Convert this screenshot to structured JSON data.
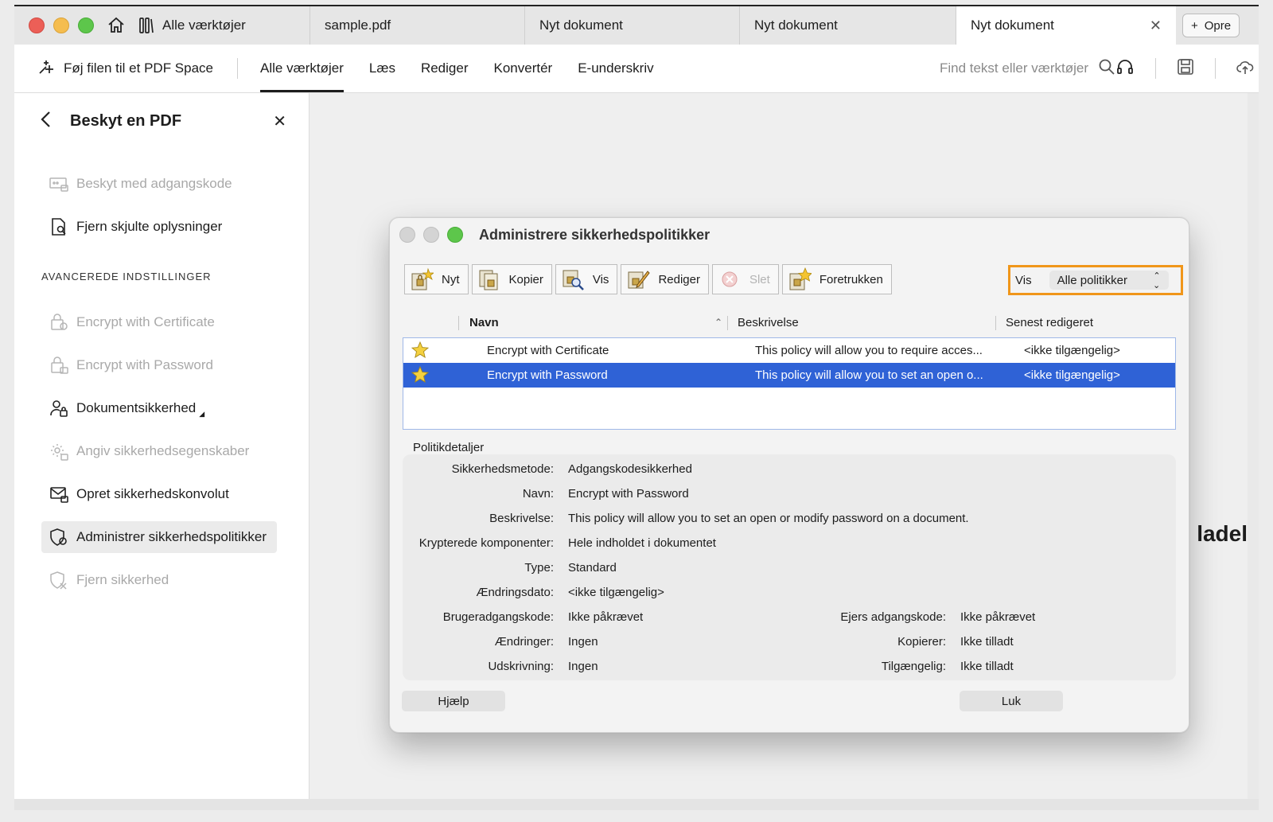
{
  "tabs": {
    "tools": "Alle værktøjer",
    "sample": "sample.pdf",
    "doc1": "Nyt dokument",
    "doc2": "Nyt dokument",
    "doc3": "Nyt dokument",
    "new_button": "Opre"
  },
  "toolbar": {
    "add_space": "Føj filen til et PDF Space",
    "menu": [
      "Alle værktøjer",
      "Læs",
      "Rediger",
      "Konvertér",
      "E-underskriv"
    ],
    "search_placeholder": "Find tekst eller værktøjer"
  },
  "panel": {
    "title": "Beskyt en PDF",
    "items_top": [
      "Beskyt med adgangskode",
      "Fjern skjulte oplysninger"
    ],
    "section": "AVANCEREDE INDSTILLINGER",
    "items_adv": [
      "Encrypt with Certificate",
      "Encrypt with Password",
      "Dokumentsikkerhed",
      "Angiv sikkerhedsegenskaber",
      "Opret sikkerhedskonvolut",
      "Administrer sikkerhedspolitikker",
      "Fjern sikkerhed"
    ]
  },
  "content": {
    "peek": "ladel"
  },
  "dialog": {
    "title": "Administrere sikkerhedspolitikker",
    "buttons": {
      "new": "Nyt",
      "copy": "Kopier",
      "view": "Vis",
      "edit": "Rediger",
      "delete": "Slet",
      "favorite": "Foretrukken"
    },
    "filter": {
      "label": "Vis",
      "value": "Alle politikker"
    },
    "columns": {
      "name": "Navn",
      "description": "Beskrivelse",
      "modified": "Senest redigeret"
    },
    "rows": [
      {
        "name": "Encrypt with Certificate",
        "description": "This policy will allow you to require acces...",
        "modified": "<ikke tilgængelig>"
      },
      {
        "name": "Encrypt with Password",
        "description": "This policy will allow you to set an open o...",
        "modified": "<ikke tilgængelig>"
      }
    ],
    "details_label": "Politikdetaljer",
    "details": {
      "method_k": "Sikkerhedsmetode:",
      "method_v": "Adgangskodesikkerhed",
      "name_k": "Navn:",
      "name_v": "Encrypt with Password",
      "desc_k": "Beskrivelse:",
      "desc_v": "This policy will allow you to set an open or modify password on a document.",
      "enc_k": "Krypterede komponenter:",
      "enc_v": "Hele indholdet i dokumentet",
      "type_k": "Type:",
      "type_v": "Standard",
      "date_k": "Ændringsdato:",
      "date_v": "<ikke tilgængelig>",
      "userpw_k": "Brugeradgangskode:",
      "userpw_v": "Ikke påkrævet",
      "ownerpw_k": "Ejers adgangskode:",
      "ownerpw_v": "Ikke påkrævet",
      "changes_k": "Ændringer:",
      "changes_v": "Ingen",
      "copy_k": "Kopierer:",
      "copy_v": "Ikke tilladt",
      "print_k": "Udskrivning:",
      "print_v": "Ingen",
      "access_k": "Tilgængelig:",
      "access_v": "Ikke tilladt"
    },
    "help": "Hjælp",
    "close": "Luk"
  },
  "colors": {
    "selection": "#2f62d6",
    "highlight_border": "#f0961a",
    "traffic_red": "#ec5f57",
    "traffic_yellow": "#f5bd4f",
    "traffic_green": "#5dc64b"
  }
}
